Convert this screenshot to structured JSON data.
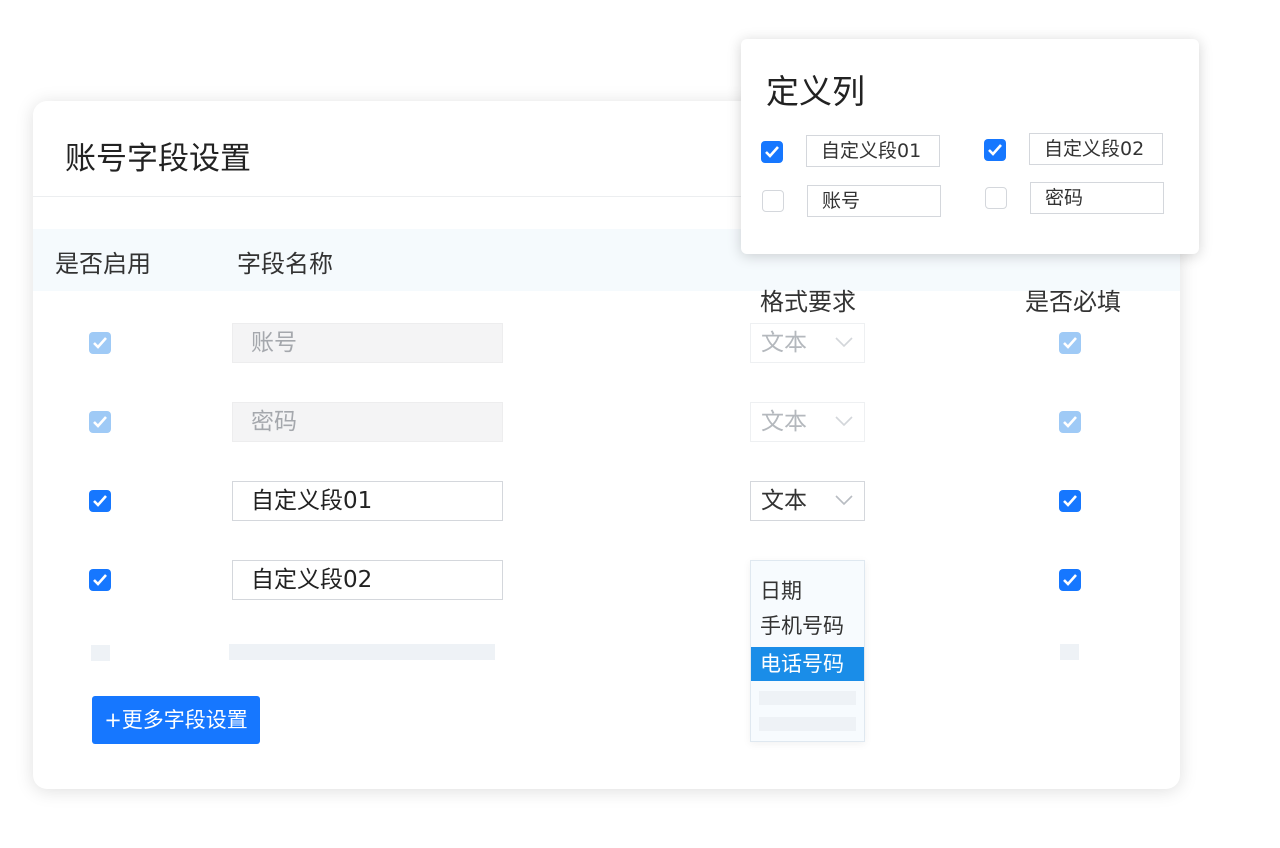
{
  "card": {
    "title": "账号字段设置",
    "headers": {
      "enabled": "是否启用",
      "field_name": "字段名称",
      "format": "格式要求",
      "required": "是否必填"
    },
    "rows": [
      {
        "field": "账号",
        "format": "文本",
        "enabled": true,
        "required": true,
        "editable": false
      },
      {
        "field": "密码",
        "format": "文本",
        "enabled": true,
        "required": true,
        "editable": false
      },
      {
        "field": "自定义段01",
        "format": "文本",
        "enabled": true,
        "required": true,
        "editable": true
      },
      {
        "field": "自定义段02",
        "format": "",
        "enabled": true,
        "required": true,
        "editable": true
      }
    ],
    "format_options": [
      "日期",
      "手机号码",
      "电话号码"
    ],
    "format_selected": "电话号码",
    "more_button": "+更多字段设置"
  },
  "popup": {
    "title": "定义列",
    "items": [
      {
        "label": "自定义段01",
        "checked": true
      },
      {
        "label": "自定义段02",
        "checked": true
      },
      {
        "label": "账号",
        "checked": false
      },
      {
        "label": "密码",
        "checked": false
      }
    ]
  },
  "colors": {
    "accent": "#1677ff",
    "checkbox_disabled": "#9fcaf6",
    "dropdown_highlight": "#1a8de8",
    "header_band": "#f5fafd"
  },
  "icons": [
    "check-icon",
    "chevron-down-icon"
  ]
}
